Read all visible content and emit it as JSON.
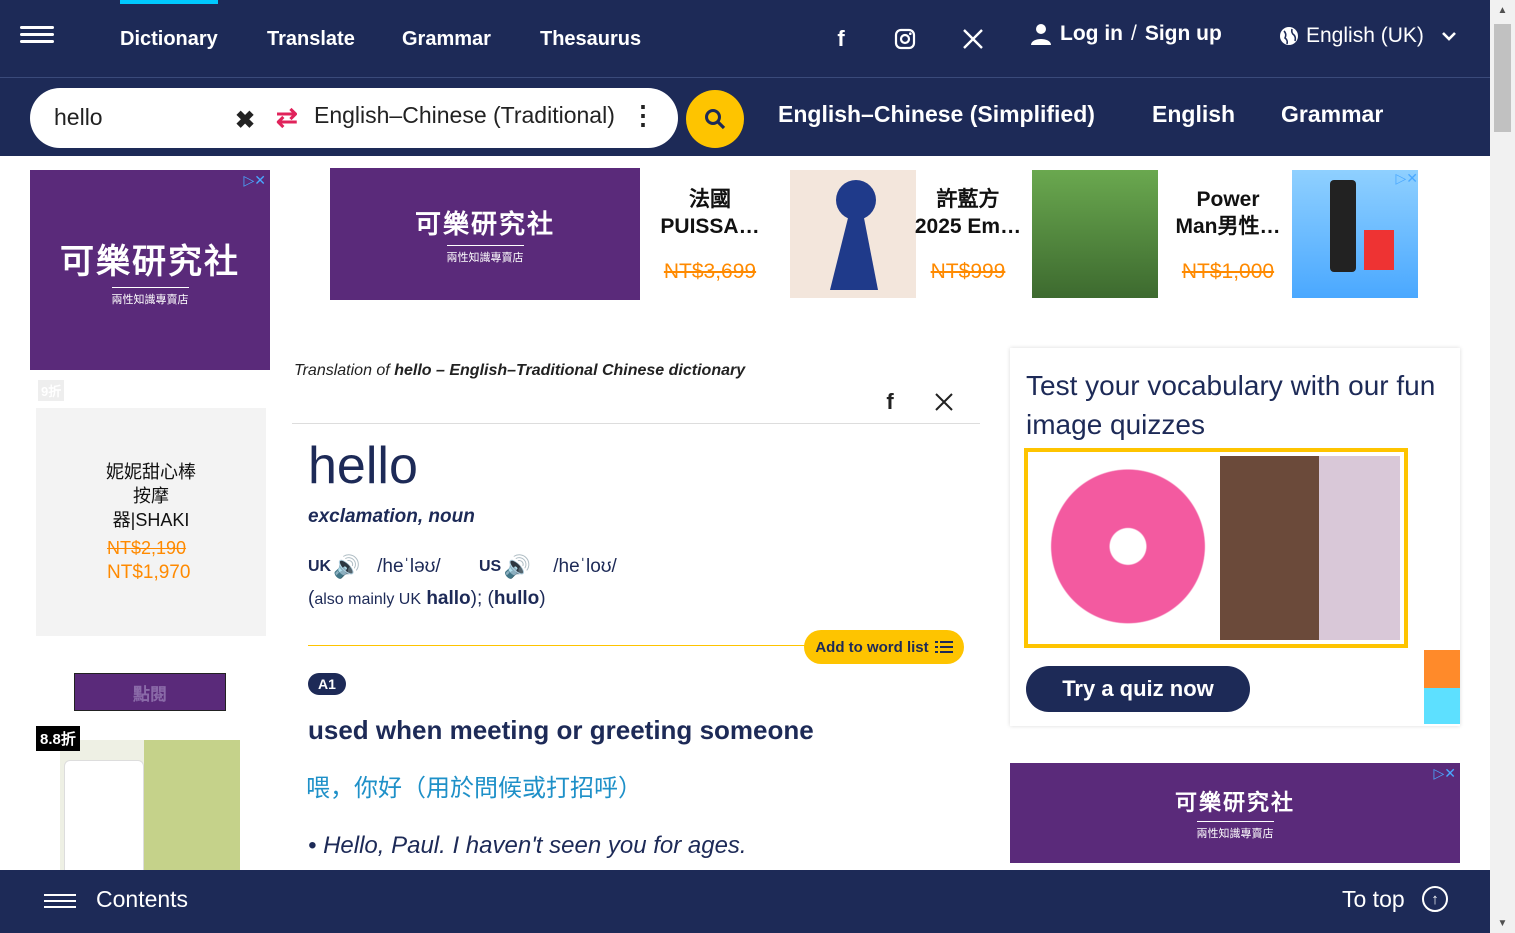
{
  "nav": {
    "tabs": [
      "Dictionary",
      "Translate",
      "Grammar",
      "Thesaurus"
    ],
    "social": [
      "facebook-icon",
      "instagram-icon",
      "x-icon"
    ],
    "login": "Log in",
    "login_sep": "/",
    "signup": "Sign up",
    "language": "English (UK)"
  },
  "search": {
    "value": "hello",
    "dictionary": "English–Chinese (Traditional)",
    "quick_links": [
      "English–Chinese (Simplified)",
      "English",
      "Grammar"
    ]
  },
  "ads": {
    "brand_name": "可樂研究社",
    "brand_sub": "兩性知識專賣店",
    "left": {
      "discount1": "9折",
      "product1": [
        "妮妮甜心棒",
        "按摩",
        "器|SHAKI"
      ],
      "old_price1": "NT$2,190",
      "new_price1": "NT$1,970",
      "button": "點閱",
      "discount2": "8.8折"
    },
    "banner": [
      {
        "title": [
          "法國",
          "PUISSA…"
        ],
        "old_price": "NT$3,699"
      },
      {
        "title": [
          "許藍方",
          "2025 Em…"
        ],
        "old_price": "NT$999"
      },
      {
        "title": [
          "Power",
          "Man男性…"
        ],
        "old_price": "NT$1,000"
      }
    ]
  },
  "entry": {
    "translation_of_prefix": "Translation of",
    "translation_of_word": "hello",
    "translation_of_suffix": "– English–Traditional Chinese dictionary",
    "headword": "hello",
    "pos": "exclamation, noun",
    "uk_label": "UK",
    "uk_ipa": "/heˈləʊ/",
    "us_label": "US",
    "us_ipa": "/heˈloʊ/",
    "also_open": "(",
    "also_text": "also mainly UK",
    "also_word1": "hallo",
    "also_mid": "); (",
    "also_word2": "hullo",
    "also_close": ")",
    "add_to_list": "Add to word list",
    "level": "A1",
    "def_parts": [
      "used when",
      "meeting",
      "or",
      "greeting",
      "someone"
    ],
    "trans_parts": [
      "喂",
      "，",
      "你好",
      "（用於問候或打招呼）"
    ],
    "example_parts": [
      "• Hello, Paul. I haven't",
      "seen",
      "you for",
      "ages."
    ]
  },
  "quiz": {
    "title": "Test your vocabulary with our fun image quizzes",
    "button": "Try a quiz now"
  },
  "bottom": {
    "contents": "Contents",
    "to_top": "To top"
  },
  "colors": {
    "navy": "#1d2a57",
    "accent_yellow": "#fec400",
    "translation_blue": "#1e90c8",
    "price_orange": "#ff8a00"
  }
}
